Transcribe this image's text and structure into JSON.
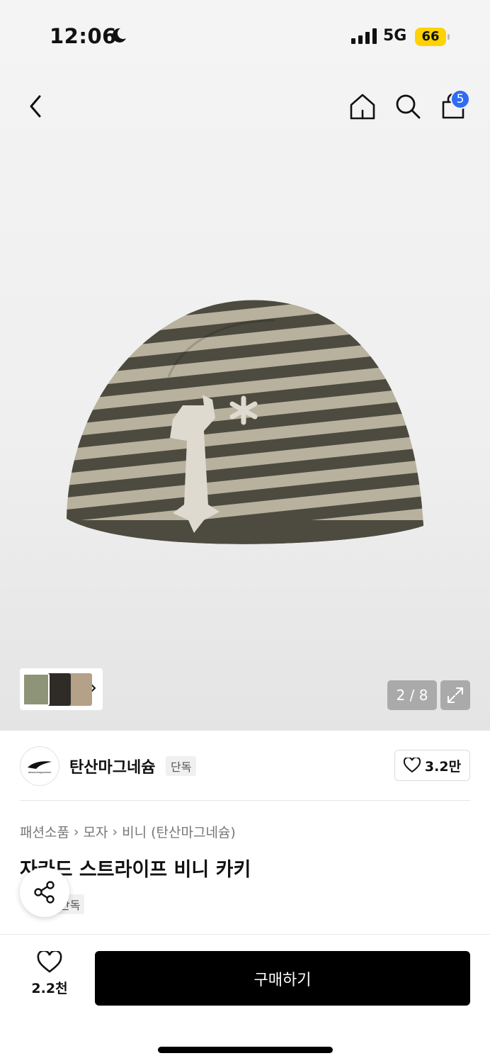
{
  "status_bar": {
    "time": "12:06",
    "network": "5G",
    "battery_level": "66"
  },
  "nav": {
    "cart_count": "5"
  },
  "gallery": {
    "counter": "2 / 8"
  },
  "brand": {
    "name": "탄산마그네슘",
    "tag": "단독",
    "like_count": "3.2만",
    "logo_text": "tansanmagnesium"
  },
  "breadcrumb": [
    "패션소품",
    "모자",
    "비니 (탄산마그네슘)"
  ],
  "product": {
    "title": "자카드 스트라이프 비니 카키",
    "tag": "단독"
  },
  "bottom": {
    "fav_count": "2.2천",
    "buy_label": "구매하기"
  },
  "colors": {
    "accent_blue": "#2f6bf3",
    "battery_yellow": "#ffd200",
    "button_black": "#000000"
  }
}
